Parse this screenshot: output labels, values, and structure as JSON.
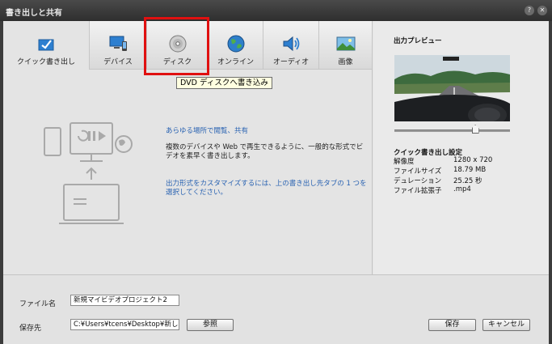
{
  "window": {
    "title": "書き出しと共有",
    "help_glyph": "?",
    "close_glyph": "✕"
  },
  "tabs": [
    {
      "label": "クイック書き出し",
      "icon": "quick-export-icon"
    },
    {
      "label": "デバイス",
      "icon": "device-icon"
    },
    {
      "label": "ディスク",
      "icon": "disc-icon"
    },
    {
      "label": "オンライン",
      "icon": "globe-icon"
    },
    {
      "label": "オーディオ",
      "icon": "speaker-icon"
    },
    {
      "label": "画像",
      "icon": "image-icon"
    }
  ],
  "active_tab": "クイック書き出し",
  "tooltip": "DVD ディスクへ書き込み",
  "content": {
    "heading": "あらゆる場所で閲覧、共有",
    "description": "複数のデバイスや Web で再生できるように、一般的な形式でビデオを素早く書き出します。",
    "hint": "出力形式をカスタマイズするには、上の書き出し先タブの 1 つを選択してください。"
  },
  "preview": {
    "label": "出力プレビュー",
    "slider_position": 0.7
  },
  "settings": {
    "title": "クイック書き出し設定",
    "rows": [
      {
        "key": "解像度",
        "value": "1280 x 720"
      },
      {
        "key": "ファイルサイズ",
        "value": "18.79 MB"
      },
      {
        "key": "デュレーション",
        "value": "25.25 秒"
      },
      {
        "key": "ファイル拡張子",
        "value": ".mp4"
      }
    ]
  },
  "form": {
    "filename_label": "ファイル名",
    "filename_value": "新規マイビデオプロジェクト2",
    "save_to_label": "保存先",
    "save_to_value": "C:¥Users¥tcens¥Desktop¥新しいフォル",
    "browse_label": "参照",
    "save_label": "保存",
    "cancel_label": "キャンセル"
  },
  "colors": {
    "accent_blue": "#2a63b2",
    "highlight_red": "#e01010",
    "tooltip_bg": "#ffffe1"
  }
}
